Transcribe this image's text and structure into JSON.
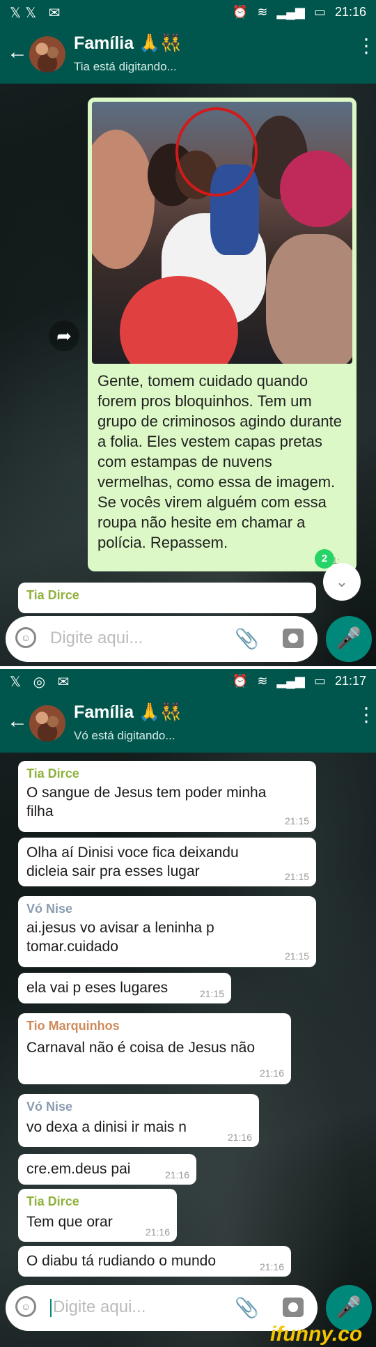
{
  "panel1": {
    "status": {
      "left_icons": "𝕏𝕏 ✉",
      "time": "21:16"
    },
    "header": {
      "title": "Família 🙏👯",
      "subtitle": "Tia está digitando..."
    },
    "outgoing": {
      "caption": "Gente, tomem cuidado quando forem pros bloquinhos. Tem um grupo de criminosos agindo durante a folia. Eles vestem capas pretas com estampas de nuvens vermelhas, como essa de imagem. Se vocês virem alguém com essa roupa não hesite em chamar a polícia. Repassem.",
      "time": "21:",
      "badge": "2"
    },
    "partial_sender": "Tia Dirce",
    "input_placeholder": "Digite aqui..."
  },
  "panel2": {
    "status": {
      "time": "21:17"
    },
    "header": {
      "title": "Família 🙏👯",
      "subtitle": "Vó está digitando..."
    },
    "messages": [
      {
        "sender": "Tia Dirce",
        "text_lines": [
          "O sangue de Jesus tem poder minha",
          "filha"
        ],
        "time": "21:15",
        "sender_color": "#8fb03a"
      },
      {
        "text_lines": [
          "Olha aí Dinisi voce fica deixandu",
          "dicleia sair pra esses lugar"
        ],
        "time": "21:15"
      },
      {
        "sender": "Vó Nise",
        "text_lines": [
          "ai.jesus vo avisar a leninha p",
          "tomar.cuidado"
        ],
        "time": "21:15",
        "sender_color": "#8a9bb0"
      },
      {
        "text_lines": [
          "ela vai p eses lugares"
        ],
        "time": "21:15"
      },
      {
        "sender": "Tio Marquinhos",
        "text_lines": [
          "Carnaval não é coisa de Jesus não"
        ],
        "time": "21:16",
        "sender_color": "#d08a5a"
      },
      {
        "sender": "Vó Nise",
        "text_lines": [
          "vo dexa a dinisi ir mais n"
        ],
        "time": "21:16",
        "sender_color": "#8a9bb0"
      },
      {
        "text_lines": [
          "cre.em.deus pai"
        ],
        "time": "21:16"
      },
      {
        "sender": "Tia Dirce",
        "text_lines": [
          "Tem que orar"
        ],
        "time": "21:16",
        "sender_color": "#8fb03a"
      },
      {
        "text_lines": [
          "O diabu tá rudiando o mundo"
        ],
        "time": "21:16"
      }
    ],
    "input_placeholder": "Digite aqui..."
  },
  "watermark": "ifunny.co",
  "colors": {
    "header": "#00564c",
    "outgoing_bubble": "#dcf8c6",
    "accent": "#00897b"
  }
}
